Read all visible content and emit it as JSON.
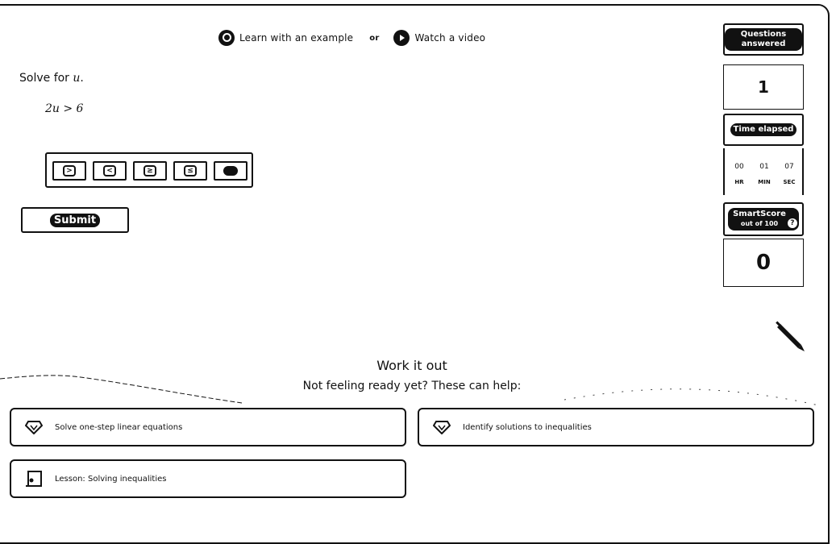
{
  "header": {
    "learn_example_label": "Learn with an example",
    "or_label": "or",
    "watch_video_label": "Watch a video"
  },
  "problem": {
    "prompt_prefix": "Solve for ",
    "variable": "u",
    "prompt_suffix": ".",
    "inequality": "2u > 6"
  },
  "toolbar": {
    "buttons": [
      {
        "icon": "greater-than-icon",
        "glyph": ">"
      },
      {
        "icon": "less-than-icon",
        "glyph": "<"
      },
      {
        "icon": "greater-or-equal-icon",
        "glyph": "≥"
      },
      {
        "icon": "less-or-equal-icon",
        "glyph": "≤"
      },
      {
        "icon": "closed-dot-icon",
        "glyph": ""
      }
    ]
  },
  "submit_label": "Submit",
  "sidebar": {
    "questions_label": "Questions answered",
    "questions_value": "1",
    "time_label": "Time elapsed",
    "time": {
      "hr": "00",
      "min": "01",
      "sec": "07",
      "hr_label": "HR",
      "min_label": "MIN",
      "sec_label": "SEC"
    },
    "smartscore_label": "SmartScore",
    "smartscore_sub": "out of 100",
    "smartscore_value": "0"
  },
  "work_it_out": {
    "title": "Work it out",
    "subtitle": "Not feeling ready yet? These can help:",
    "cards": [
      {
        "icon": "diamond-skill-icon",
        "label": "Solve one-step linear equations"
      },
      {
        "icon": "diamond-skill-icon",
        "label": "Identify solutions to inequalities"
      },
      {
        "icon": "lesson-icon",
        "label": "Lesson: Solving inequalities"
      }
    ]
  },
  "colors": {
    "ink": "#111111",
    "background": "#ffffff"
  }
}
